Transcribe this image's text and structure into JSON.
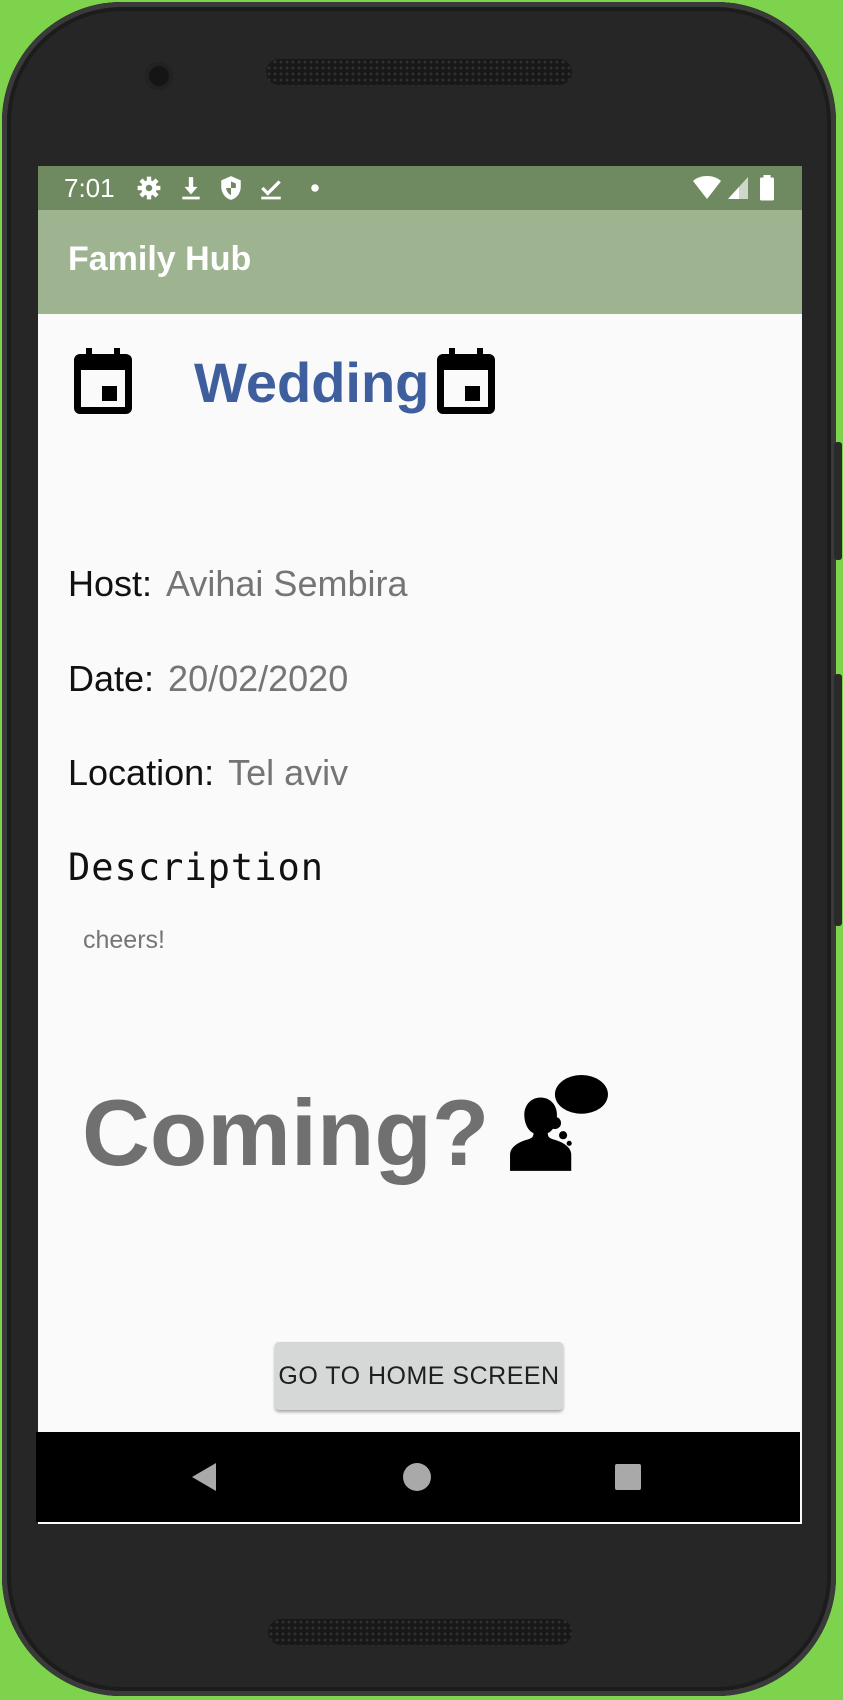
{
  "status_bar": {
    "time": "7:01",
    "left_icons": [
      "gear-icon",
      "download-icon",
      "shield-icon",
      "check-icon",
      "dot-icon"
    ],
    "right_icons": [
      "wifi-icon",
      "signal-icon",
      "battery-icon"
    ]
  },
  "app_bar": {
    "title": "Family Hub"
  },
  "event": {
    "title": "Wedding",
    "host_label": "Host:",
    "host_value": "Avihai Sembira",
    "date_label": "Date:",
    "date_value": "20/02/2020",
    "location_label": "Location:",
    "location_value": "Tel aviv",
    "description_label": "Description",
    "description_text": "cheers!"
  },
  "rsvp": {
    "prompt": "Coming?"
  },
  "actions": {
    "home_button": "GO TO HOME SCREEN"
  },
  "colors": {
    "status_bar": "#6f8a60",
    "app_bar": "#9eb38f",
    "event_title": "#3f5e9d",
    "frame_background": "#7dd34b"
  }
}
